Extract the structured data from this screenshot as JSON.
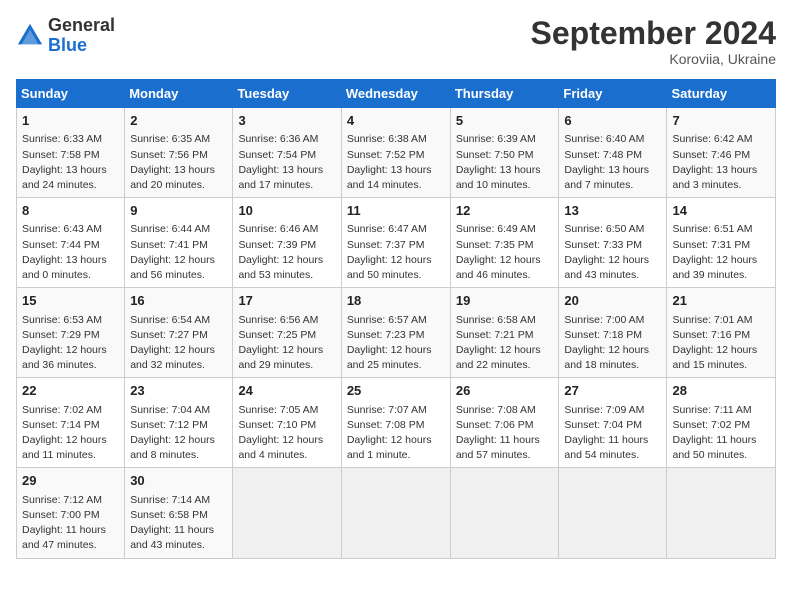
{
  "logo": {
    "general": "General",
    "blue": "Blue"
  },
  "header": {
    "month": "September 2024",
    "location": "Koroviia, Ukraine"
  },
  "weekdays": [
    "Sunday",
    "Monday",
    "Tuesday",
    "Wednesday",
    "Thursday",
    "Friday",
    "Saturday"
  ],
  "weeks": [
    [
      {
        "day": "1",
        "info": "Sunrise: 6:33 AM\nSunset: 7:58 PM\nDaylight: 13 hours\nand 24 minutes."
      },
      {
        "day": "2",
        "info": "Sunrise: 6:35 AM\nSunset: 7:56 PM\nDaylight: 13 hours\nand 20 minutes."
      },
      {
        "day": "3",
        "info": "Sunrise: 6:36 AM\nSunset: 7:54 PM\nDaylight: 13 hours\nand 17 minutes."
      },
      {
        "day": "4",
        "info": "Sunrise: 6:38 AM\nSunset: 7:52 PM\nDaylight: 13 hours\nand 14 minutes."
      },
      {
        "day": "5",
        "info": "Sunrise: 6:39 AM\nSunset: 7:50 PM\nDaylight: 13 hours\nand 10 minutes."
      },
      {
        "day": "6",
        "info": "Sunrise: 6:40 AM\nSunset: 7:48 PM\nDaylight: 13 hours\nand 7 minutes."
      },
      {
        "day": "7",
        "info": "Sunrise: 6:42 AM\nSunset: 7:46 PM\nDaylight: 13 hours\nand 3 minutes."
      }
    ],
    [
      {
        "day": "8",
        "info": "Sunrise: 6:43 AM\nSunset: 7:44 PM\nDaylight: 13 hours\nand 0 minutes."
      },
      {
        "day": "9",
        "info": "Sunrise: 6:44 AM\nSunset: 7:41 PM\nDaylight: 12 hours\nand 56 minutes."
      },
      {
        "day": "10",
        "info": "Sunrise: 6:46 AM\nSunset: 7:39 PM\nDaylight: 12 hours\nand 53 minutes."
      },
      {
        "day": "11",
        "info": "Sunrise: 6:47 AM\nSunset: 7:37 PM\nDaylight: 12 hours\nand 50 minutes."
      },
      {
        "day": "12",
        "info": "Sunrise: 6:49 AM\nSunset: 7:35 PM\nDaylight: 12 hours\nand 46 minutes."
      },
      {
        "day": "13",
        "info": "Sunrise: 6:50 AM\nSunset: 7:33 PM\nDaylight: 12 hours\nand 43 minutes."
      },
      {
        "day": "14",
        "info": "Sunrise: 6:51 AM\nSunset: 7:31 PM\nDaylight: 12 hours\nand 39 minutes."
      }
    ],
    [
      {
        "day": "15",
        "info": "Sunrise: 6:53 AM\nSunset: 7:29 PM\nDaylight: 12 hours\nand 36 minutes."
      },
      {
        "day": "16",
        "info": "Sunrise: 6:54 AM\nSunset: 7:27 PM\nDaylight: 12 hours\nand 32 minutes."
      },
      {
        "day": "17",
        "info": "Sunrise: 6:56 AM\nSunset: 7:25 PM\nDaylight: 12 hours\nand 29 minutes."
      },
      {
        "day": "18",
        "info": "Sunrise: 6:57 AM\nSunset: 7:23 PM\nDaylight: 12 hours\nand 25 minutes."
      },
      {
        "day": "19",
        "info": "Sunrise: 6:58 AM\nSunset: 7:21 PM\nDaylight: 12 hours\nand 22 minutes."
      },
      {
        "day": "20",
        "info": "Sunrise: 7:00 AM\nSunset: 7:18 PM\nDaylight: 12 hours\nand 18 minutes."
      },
      {
        "day": "21",
        "info": "Sunrise: 7:01 AM\nSunset: 7:16 PM\nDaylight: 12 hours\nand 15 minutes."
      }
    ],
    [
      {
        "day": "22",
        "info": "Sunrise: 7:02 AM\nSunset: 7:14 PM\nDaylight: 12 hours\nand 11 minutes."
      },
      {
        "day": "23",
        "info": "Sunrise: 7:04 AM\nSunset: 7:12 PM\nDaylight: 12 hours\nand 8 minutes."
      },
      {
        "day": "24",
        "info": "Sunrise: 7:05 AM\nSunset: 7:10 PM\nDaylight: 12 hours\nand 4 minutes."
      },
      {
        "day": "25",
        "info": "Sunrise: 7:07 AM\nSunset: 7:08 PM\nDaylight: 12 hours\nand 1 minute."
      },
      {
        "day": "26",
        "info": "Sunrise: 7:08 AM\nSunset: 7:06 PM\nDaylight: 11 hours\nand 57 minutes."
      },
      {
        "day": "27",
        "info": "Sunrise: 7:09 AM\nSunset: 7:04 PM\nDaylight: 11 hours\nand 54 minutes."
      },
      {
        "day": "28",
        "info": "Sunrise: 7:11 AM\nSunset: 7:02 PM\nDaylight: 11 hours\nand 50 minutes."
      }
    ],
    [
      {
        "day": "29",
        "info": "Sunrise: 7:12 AM\nSunset: 7:00 PM\nDaylight: 11 hours\nand 47 minutes."
      },
      {
        "day": "30",
        "info": "Sunrise: 7:14 AM\nSunset: 6:58 PM\nDaylight: 11 hours\nand 43 minutes."
      },
      {
        "day": "",
        "info": ""
      },
      {
        "day": "",
        "info": ""
      },
      {
        "day": "",
        "info": ""
      },
      {
        "day": "",
        "info": ""
      },
      {
        "day": "",
        "info": ""
      }
    ]
  ]
}
